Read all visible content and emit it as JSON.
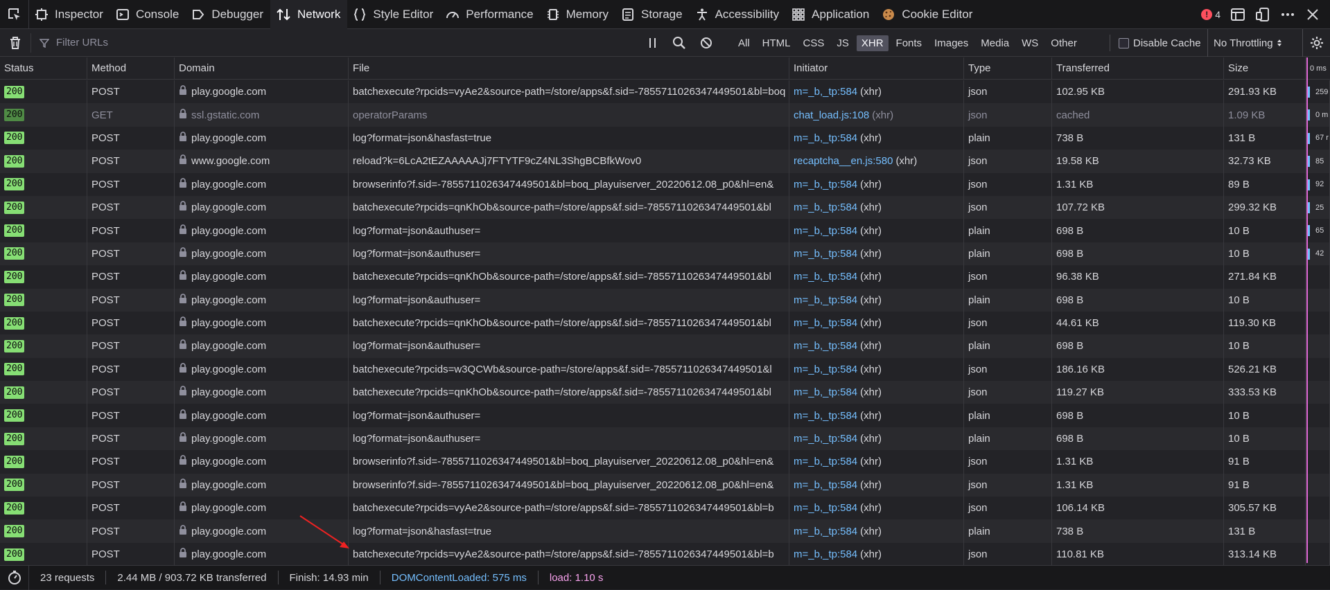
{
  "toolbar": {
    "tabs": [
      {
        "label": "Inspector",
        "icon": "inspector-icon"
      },
      {
        "label": "Console",
        "icon": "console-icon"
      },
      {
        "label": "Debugger",
        "icon": "debugger-icon"
      },
      {
        "label": "Network",
        "icon": "network-icon",
        "selected": true
      },
      {
        "label": "Style Editor",
        "icon": "style-editor-icon"
      },
      {
        "label": "Performance",
        "icon": "performance-icon"
      },
      {
        "label": "Memory",
        "icon": "memory-icon"
      },
      {
        "label": "Storage",
        "icon": "storage-icon"
      },
      {
        "label": "Accessibility",
        "icon": "accessibility-icon"
      },
      {
        "label": "Application",
        "icon": "application-icon"
      },
      {
        "label": "Cookie Editor",
        "icon": "cookie-icon"
      }
    ],
    "error_count": "4"
  },
  "filter": {
    "placeholder": "Filter URLs",
    "types": [
      "All",
      "HTML",
      "CSS",
      "JS",
      "XHR",
      "Fonts",
      "Images",
      "Media",
      "WS",
      "Other"
    ],
    "active_type": "XHR",
    "disable_cache_label": "Disable Cache",
    "throttling_label": "No Throttling"
  },
  "columns": {
    "status": "Status",
    "method": "Method",
    "domain": "Domain",
    "file": "File",
    "initiator": "Initiator",
    "type": "Type",
    "transferred": "Transferred",
    "size": "Size",
    "waterfall": "0 ms"
  },
  "rows": [
    {
      "status": "200",
      "method": "POST",
      "domain": "play.google.com",
      "file": "batchexecute?rpcids=vyAe2&source-path=/store/apps&f.sid=-7855711026347449501&bl=boq",
      "init": "m=_b,_tp:584",
      "init_suffix": "(xhr)",
      "type": "json",
      "transferred": "102.95 KB",
      "size": "291.93 KB",
      "wf": "259"
    },
    {
      "status": "200",
      "method": "GET",
      "domain": "ssl.gstatic.com",
      "file": "operatorParams",
      "init": "chat_load.js:108",
      "init_suffix": "(xhr)",
      "type": "json",
      "transferred": "cached",
      "size": "1.09 KB",
      "wf": "0 m",
      "cached": true
    },
    {
      "status": "200",
      "method": "POST",
      "domain": "play.google.com",
      "file": "log?format=json&hasfast=true",
      "init": "m=_b,_tp:584",
      "init_suffix": "(xhr)",
      "type": "plain",
      "transferred": "738 B",
      "size": "131 B",
      "wf": "67 r"
    },
    {
      "status": "200",
      "method": "POST",
      "domain": "www.google.com",
      "file": "reload?k=6LcA2tEZAAAAAJj7FTYTF9cZ4NL3ShgBCBfkWov0",
      "init": "recaptcha__en.js:580",
      "init_suffix": "(xhr)",
      "type": "json",
      "transferred": "19.58 KB",
      "size": "32.73 KB",
      "wf": "85"
    },
    {
      "status": "200",
      "method": "POST",
      "domain": "play.google.com",
      "file": "browserinfo?f.sid=-7855711026347449501&bl=boq_playuiserver_20220612.08_p0&hl=en&",
      "init": "m=_b,_tp:584",
      "init_suffix": "(xhr)",
      "type": "json",
      "transferred": "1.31 KB",
      "size": "89 B",
      "wf": "92"
    },
    {
      "status": "200",
      "method": "POST",
      "domain": "play.google.com",
      "file": "batchexecute?rpcids=qnKhOb&source-path=/store/apps&f.sid=-7855711026347449501&bl",
      "init": "m=_b,_tp:584",
      "init_suffix": "(xhr)",
      "type": "json",
      "transferred": "107.72 KB",
      "size": "299.32 KB",
      "wf": "25"
    },
    {
      "status": "200",
      "method": "POST",
      "domain": "play.google.com",
      "file": "log?format=json&authuser=",
      "init": "m=_b,_tp:584",
      "init_suffix": "(xhr)",
      "type": "plain",
      "transferred": "698 B",
      "size": "10 B",
      "wf": "65"
    },
    {
      "status": "200",
      "method": "POST",
      "domain": "play.google.com",
      "file": "log?format=json&authuser=",
      "init": "m=_b,_tp:584",
      "init_suffix": "(xhr)",
      "type": "plain",
      "transferred": "698 B",
      "size": "10 B",
      "wf": "42"
    },
    {
      "status": "200",
      "method": "POST",
      "domain": "play.google.com",
      "file": "batchexecute?rpcids=qnKhOb&source-path=/store/apps&f.sid=-7855711026347449501&bl",
      "init": "m=_b,_tp:584",
      "init_suffix": "(xhr)",
      "type": "json",
      "transferred": "96.38 KB",
      "size": "271.84 KB",
      "wf": ""
    },
    {
      "status": "200",
      "method": "POST",
      "domain": "play.google.com",
      "file": "log?format=json&authuser=",
      "init": "m=_b,_tp:584",
      "init_suffix": "(xhr)",
      "type": "plain",
      "transferred": "698 B",
      "size": "10 B",
      "wf": ""
    },
    {
      "status": "200",
      "method": "POST",
      "domain": "play.google.com",
      "file": "batchexecute?rpcids=qnKhOb&source-path=/store/apps&f.sid=-7855711026347449501&bl",
      "init": "m=_b,_tp:584",
      "init_suffix": "(xhr)",
      "type": "json",
      "transferred": "44.61 KB",
      "size": "119.30 KB",
      "wf": ""
    },
    {
      "status": "200",
      "method": "POST",
      "domain": "play.google.com",
      "file": "log?format=json&authuser=",
      "init": "m=_b,_tp:584",
      "init_suffix": "(xhr)",
      "type": "plain",
      "transferred": "698 B",
      "size": "10 B",
      "wf": ""
    },
    {
      "status": "200",
      "method": "POST",
      "domain": "play.google.com",
      "file": "batchexecute?rpcids=w3QCWb&source-path=/store/apps&f.sid=-7855711026347449501&l",
      "init": "m=_b,_tp:584",
      "init_suffix": "(xhr)",
      "type": "json",
      "transferred": "186.16 KB",
      "size": "526.21 KB",
      "wf": ""
    },
    {
      "status": "200",
      "method": "POST",
      "domain": "play.google.com",
      "file": "batchexecute?rpcids=qnKhOb&source-path=/store/apps&f.sid=-7855711026347449501&bl",
      "init": "m=_b,_tp:584",
      "init_suffix": "(xhr)",
      "type": "json",
      "transferred": "119.27 KB",
      "size": "333.53 KB",
      "wf": ""
    },
    {
      "status": "200",
      "method": "POST",
      "domain": "play.google.com",
      "file": "log?format=json&authuser=",
      "init": "m=_b,_tp:584",
      "init_suffix": "(xhr)",
      "type": "plain",
      "transferred": "698 B",
      "size": "10 B",
      "wf": ""
    },
    {
      "status": "200",
      "method": "POST",
      "domain": "play.google.com",
      "file": "log?format=json&authuser=",
      "init": "m=_b,_tp:584",
      "init_suffix": "(xhr)",
      "type": "plain",
      "transferred": "698 B",
      "size": "10 B",
      "wf": ""
    },
    {
      "status": "200",
      "method": "POST",
      "domain": "play.google.com",
      "file": "browserinfo?f.sid=-7855711026347449501&bl=boq_playuiserver_20220612.08_p0&hl=en&",
      "init": "m=_b,_tp:584",
      "init_suffix": "(xhr)",
      "type": "json",
      "transferred": "1.31 KB",
      "size": "91 B",
      "wf": ""
    },
    {
      "status": "200",
      "method": "POST",
      "domain": "play.google.com",
      "file": "browserinfo?f.sid=-7855711026347449501&bl=boq_playuiserver_20220612.08_p0&hl=en&",
      "init": "m=_b,_tp:584",
      "init_suffix": "(xhr)",
      "type": "json",
      "transferred": "1.31 KB",
      "size": "91 B",
      "wf": ""
    },
    {
      "status": "200",
      "method": "POST",
      "domain": "play.google.com",
      "file": "batchexecute?rpcids=vyAe2&source-path=/store/apps&f.sid=-7855711026347449501&bl=b",
      "init": "m=_b,_tp:584",
      "init_suffix": "(xhr)",
      "type": "json",
      "transferred": "106.14 KB",
      "size": "305.57 KB",
      "wf": ""
    },
    {
      "status": "200",
      "method": "POST",
      "domain": "play.google.com",
      "file": "log?format=json&hasfast=true",
      "init": "m=_b,_tp:584",
      "init_suffix": "(xhr)",
      "type": "plain",
      "transferred": "738 B",
      "size": "131 B",
      "wf": ""
    },
    {
      "status": "200",
      "method": "POST",
      "domain": "play.google.com",
      "file": "batchexecute?rpcids=vyAe2&source-path=/store/apps&f.sid=-7855711026347449501&bl=b",
      "init": "m=_b,_tp:584",
      "init_suffix": "(xhr)",
      "type": "json",
      "transferred": "110.81 KB",
      "size": "313.14 KB",
      "wf": ""
    }
  ],
  "statusbar": {
    "requests": "23 requests",
    "transferred": "2.44 MB / 903.72 KB transferred",
    "finish": "Finish: 14.93 min",
    "dom_loaded": "DOMContentLoaded: 575 ms",
    "load": "load: 1.10 s"
  }
}
